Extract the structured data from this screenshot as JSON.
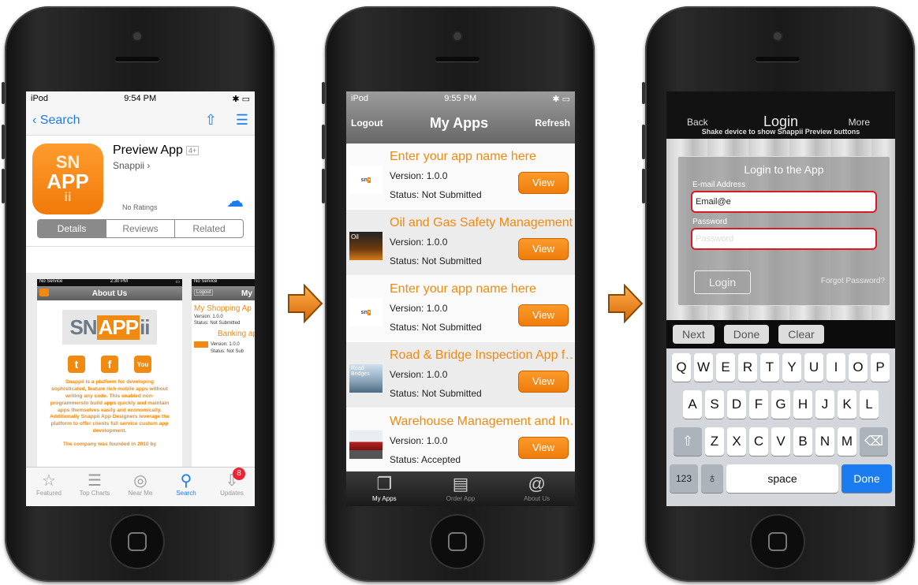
{
  "phone1": {
    "status": {
      "carrier": "iPod",
      "time": "9:54 PM"
    },
    "nav": {
      "back_label": "Search"
    },
    "app": {
      "name": "Preview App",
      "age": "4+",
      "developer": "Snappii",
      "ratings": "No Ratings",
      "icon_line1": "SN",
      "icon_line2": "APP",
      "icon_line3": "ii"
    },
    "segments": [
      "Details",
      "Reviews",
      "Related"
    ],
    "shot_a": {
      "status_left": "No Service",
      "status_time": "2:30 PM",
      "title": "About Us",
      "logo_left": "SN",
      "logo_mid": "APP",
      "logo_right": "ii",
      "social": [
        "t",
        "f",
        "You"
      ],
      "body": "Snappii is a platform for developing sophisticated, feature rich mobile apps without writing any code. This enabled non-programmersto build apps quickly and maintain apps themselves easily and economically. Additionally Snappii App Designers leverage the platform to offer clients full service custom app development.",
      "footer": "The company was founded in 2010 by"
    },
    "shot_b": {
      "status_left": "No Service",
      "logout": "Logout",
      "title": "My",
      "app1_name": "My Shopping Ap",
      "app1_version": "Version: 1.0.0",
      "app1_status": "Status: Not Submitted",
      "app2_name": "Banking ap",
      "app2_version": "Version: 1.0.0",
      "app2_status": "Status: Not Sub"
    },
    "tabs": [
      {
        "label": "Featured",
        "icon": "star-icon"
      },
      {
        "label": "Top Charts",
        "icon": "list-icon"
      },
      {
        "label": "Near Me",
        "icon": "compass-icon"
      },
      {
        "label": "Search",
        "icon": "search-icon"
      },
      {
        "label": "Updates",
        "icon": "download-icon",
        "badge": "8"
      }
    ]
  },
  "phone2": {
    "status": {
      "carrier": "iPod",
      "time": "9:55 PM"
    },
    "nav": {
      "left": "Logout",
      "title": "My Apps",
      "right": "Refresh"
    },
    "apps": [
      {
        "name": "Enter your app name here",
        "version": "Version: 1.0.0",
        "status": "Status: Not Submitted",
        "button": "View",
        "thumb_text": "sn"
      },
      {
        "name": "Oil and Gas Safety Management…",
        "version": "Version: 1.0.0",
        "status": "Status: Not Submitted",
        "button": "View",
        "thumb_text": "Oil"
      },
      {
        "name": "Enter your app name here",
        "version": "Version: 1.0.0",
        "status": "Status: Not Submitted",
        "button": "View",
        "thumb_text": "sn"
      },
      {
        "name": "Road & Bridge Inspection App f…",
        "version": "Version: 1.0.0",
        "status": "Status: Not Submitted",
        "button": "View",
        "thumb_text": "Road Bridges"
      },
      {
        "name": "Warehouse Management and In…",
        "version": "Version: 1.0.0",
        "status": "Status: Accepted",
        "button": "View",
        "thumb_text": ""
      }
    ],
    "tabs": [
      {
        "label": "My Apps",
        "icon": "copy-icon"
      },
      {
        "label": "Order App",
        "icon": "pages-icon"
      },
      {
        "label": "About Us",
        "icon": "at-icon"
      }
    ]
  },
  "phone3": {
    "nav": {
      "back": "Back",
      "title": "Login",
      "more": "More",
      "hint": "Shake device to show Snappii Preview buttons"
    },
    "form": {
      "heading": "Login to the App",
      "email_label": "E-mail Address",
      "email_value": "Email@e",
      "password_label": "Password",
      "password_placeholder": "Password",
      "login_button": "Login",
      "forgot": "Forgot Password?"
    },
    "accessory": [
      "Next",
      "Done",
      "Clear"
    ],
    "keyboard": {
      "row1": [
        "Q",
        "W",
        "E",
        "R",
        "T",
        "Y",
        "U",
        "I",
        "O",
        "P"
      ],
      "row2": [
        "A",
        "S",
        "D",
        "F",
        "G",
        "H",
        "J",
        "K",
        "L"
      ],
      "row3": [
        "Z",
        "X",
        "C",
        "V",
        "B",
        "N",
        "M"
      ],
      "numbers": "123",
      "space": "space",
      "done": "Done"
    }
  },
  "colors": {
    "accent": "#f08a10",
    "ios_blue": "#1a7cf0",
    "error_red": "#d81b24"
  }
}
